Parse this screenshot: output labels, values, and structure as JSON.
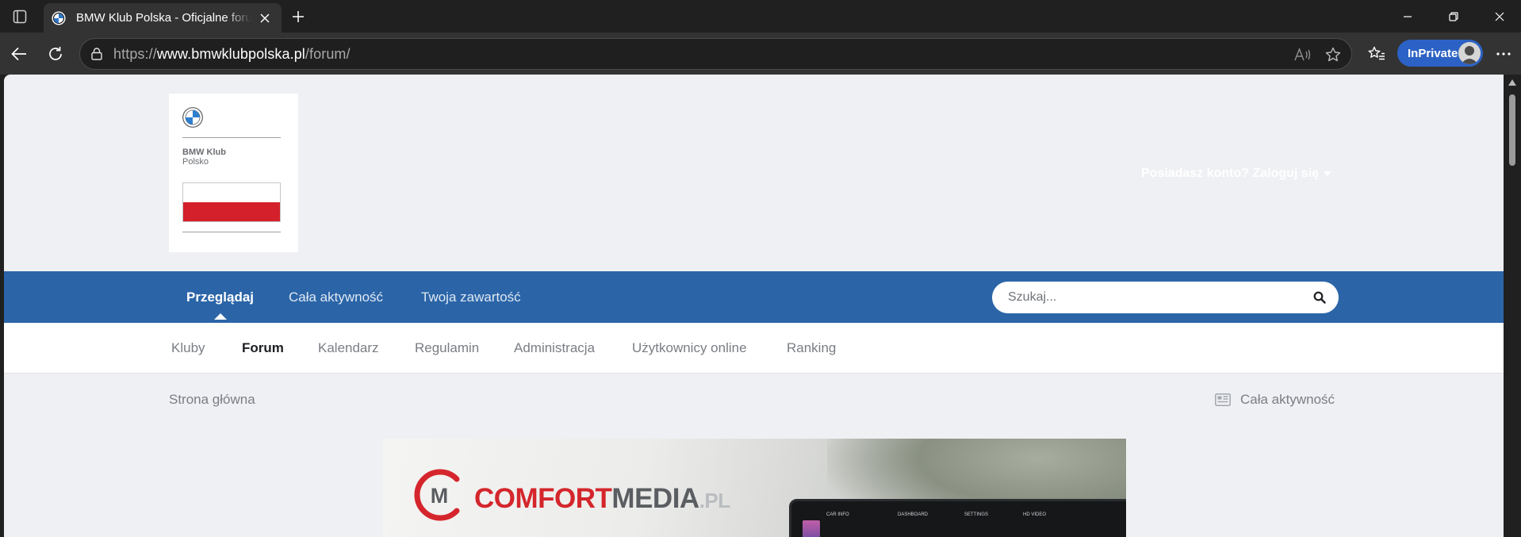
{
  "browser": {
    "tab_title": "BMW Klub Polska - Oficjalne forum",
    "url_scheme": "https://",
    "url_host": "www.bmwklubpolska.pl",
    "url_path": "/forum/",
    "inprivate_label": "InPrivate"
  },
  "header": {
    "logo_name": "BMW Klub",
    "logo_country": "Polsko",
    "signin_label": "Posiadasz konto? Zaloguj się"
  },
  "primary_nav": {
    "items": [
      {
        "label": "Przeglądaj",
        "active": true
      },
      {
        "label": "Cała aktywność",
        "active": false
      },
      {
        "label": "Twoja zawartość",
        "active": false
      }
    ],
    "search_placeholder": "Szukaj..."
  },
  "secondary_nav": {
    "items": [
      {
        "label": "Kluby",
        "active": false
      },
      {
        "label": "Forum",
        "active": true
      },
      {
        "label": "Kalendarz",
        "active": false
      },
      {
        "label": "Regulamin",
        "active": false
      },
      {
        "label": "Administracja",
        "active": false
      },
      {
        "label": "Użytkownicy online",
        "active": false
      },
      {
        "label": "Ranking",
        "active": false
      }
    ]
  },
  "breadcrumb": {
    "home": "Strona główna",
    "activity_link": "Cała aktywność"
  },
  "banner": {
    "brand_comfort": "COMFORT",
    "brand_media": "MEDIA",
    "brand_tld": ".PL",
    "logo_letter": "M",
    "screen_labels": [
      "CAR INFO",
      "DASHBOARD",
      "SETTINGS",
      "HD VIDEO"
    ]
  },
  "colors": {
    "primary_nav_bg": "#2b65a8",
    "page_bg": "#eff0f3",
    "brand_red": "#d4262c",
    "inprivate_bg": "#2c62c5"
  }
}
